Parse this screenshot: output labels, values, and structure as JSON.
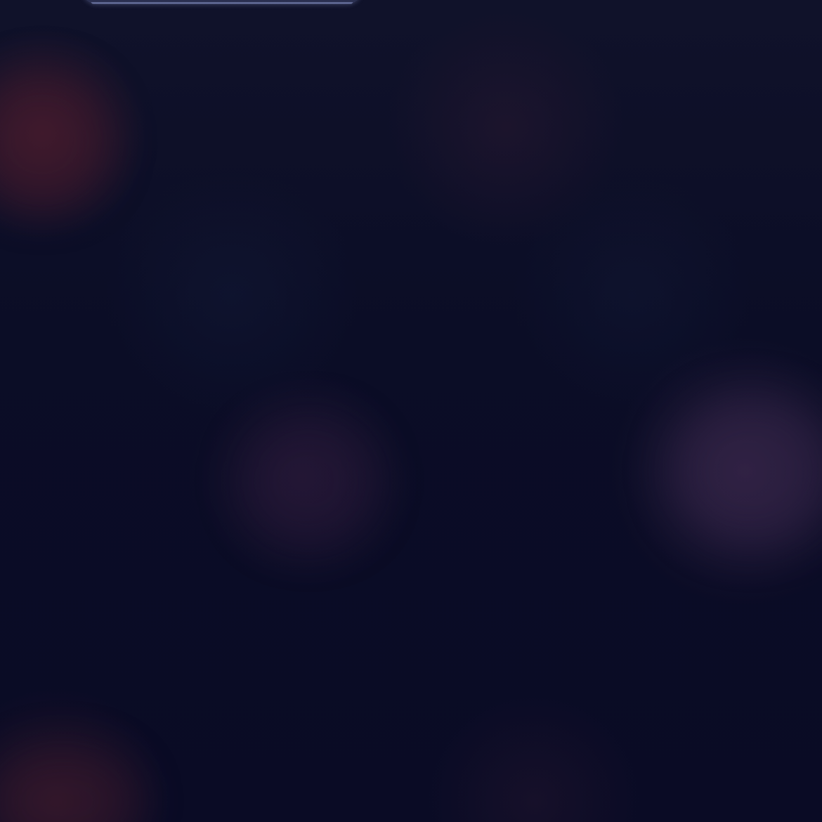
{
  "screen": {
    "description_colors": {
      "base": "#0b0c24",
      "warm_glow": "#501e2d",
      "violet_glow": "#3c284b",
      "card_edge": "#828cbe"
    }
  }
}
